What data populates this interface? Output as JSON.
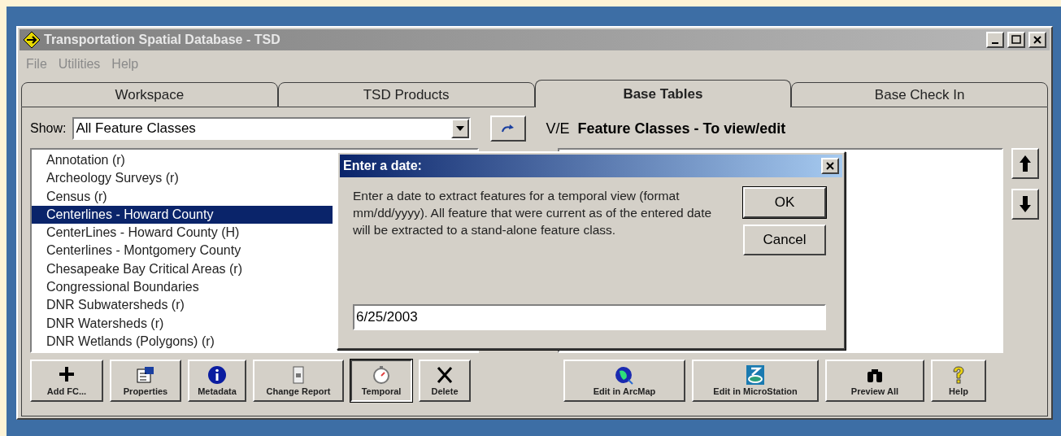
{
  "window": {
    "title": "Transportation Spatial Database - TSD"
  },
  "menu": [
    "File",
    "Utilities",
    "Help"
  ],
  "tabs": [
    {
      "label": "Workspace",
      "selected": false
    },
    {
      "label": "TSD Products",
      "selected": false
    },
    {
      "label": "Base Tables",
      "selected": true
    },
    {
      "label": "Base Check In",
      "selected": false
    }
  ],
  "show": {
    "label": "Show:",
    "value": "All Feature Classes"
  },
  "header": {
    "prefix": "V/E",
    "title": "Feature Classes - To view/edit"
  },
  "feature_classes": [
    {
      "label": "Annotation (r)",
      "selected": false
    },
    {
      "label": "Archeology Surveys (r)",
      "selected": false
    },
    {
      "label": "Census (r)",
      "selected": false
    },
    {
      "label": "Centerlines - Howard County",
      "selected": true
    },
    {
      "label": "CenterLines - Howard County (H)",
      "selected": false
    },
    {
      "label": "Centerlines - Montgomery County",
      "selected": false
    },
    {
      "label": "Chesapeake Bay Critical Areas (r)",
      "selected": false
    },
    {
      "label": "Congressional Boundaries",
      "selected": false
    },
    {
      "label": "DNR Subwatersheds (r)",
      "selected": false
    },
    {
      "label": "DNR Watersheds (r)",
      "selected": false
    },
    {
      "label": "DNR Wetlands (Polygons) (r)",
      "selected": false
    }
  ],
  "left_toolbar": [
    {
      "label": "Add FC...",
      "pressed": false
    },
    {
      "label": "Properties",
      "pressed": false
    },
    {
      "label": "Metadata",
      "pressed": false
    },
    {
      "label": "Change Report",
      "pressed": false
    },
    {
      "label": "Temporal",
      "pressed": true
    },
    {
      "label": "Delete",
      "pressed": false
    }
  ],
  "right_toolbar": [
    {
      "label": "Edit in ArcMap"
    },
    {
      "label": "Edit in MicroStation"
    },
    {
      "label": "Preview All"
    },
    {
      "label": "Help"
    }
  ],
  "dialog": {
    "title": "Enter a date:",
    "message": "Enter a date to extract features for a temporal view (format mm/dd/yyyy).  All feature that were current as of the entered date will be extracted to a stand-alone feature class.",
    "value": "6/25/2003",
    "buttons": [
      {
        "label": "OK",
        "default": true
      },
      {
        "label": "Cancel",
        "default": false
      }
    ]
  }
}
